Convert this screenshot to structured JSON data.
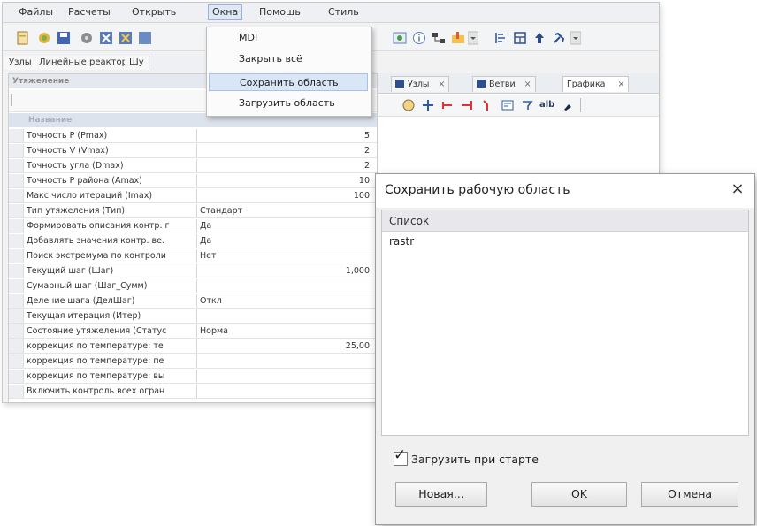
{
  "menubar": {
    "items": [
      "Файлы",
      "Расчеты",
      "Открыть",
      "Окна",
      "Помощь",
      "Стиль"
    ]
  },
  "tabs": [
    "Узлы",
    "Линейные реакторы",
    "Шу"
  ],
  "dropdown": {
    "items": [
      "MDI",
      "Закрыть всё",
      "Сохранить область",
      "Загрузить область"
    ]
  },
  "grid": {
    "title": "Утяжеление",
    "header": "Название",
    "rows": [
      {
        "name": "Точность P (Pmax)",
        "value": "5"
      },
      {
        "name": "Точность V (Vmax)",
        "value": "2"
      },
      {
        "name": "Точность угла (Dmax)",
        "value": "2"
      },
      {
        "name": "Точность P района (Amax)",
        "value": "10"
      },
      {
        "name": "Макс число итераций (Imax)",
        "value": "100"
      },
      {
        "name": "Тип утяжеления (Тип)",
        "value": "Стандарт"
      },
      {
        "name": "Формировать описания контр. г",
        "value": "Да"
      },
      {
        "name": "Добавлять значения контр. ве.",
        "value": "Да"
      },
      {
        "name": "Поиск экстремума по контроли",
        "value": "Нет"
      },
      {
        "name": "Текущий шаг (Шаг)",
        "value": "1,000"
      },
      {
        "name": "Сумарный шаг (Шаг_Сумм)",
        "value": ""
      },
      {
        "name": "Деление шага (ДелШаг)",
        "value": "Откл"
      },
      {
        "name": "Текущая итерация (Итер)",
        "value": ""
      },
      {
        "name": "Состояние утяжеления (Статус",
        "value": "Норма"
      },
      {
        "name": "коррекция по температуре: те",
        "value": "25,00"
      },
      {
        "name": "коррекция по температуре: пе",
        "value": ""
      },
      {
        "name": "коррекция по температуре: вы",
        "value": ""
      },
      {
        "name": "Включить контроль всех огран",
        "value": ""
      }
    ]
  },
  "right_panel": {
    "tabs": [
      "Узлы",
      "Ветви",
      "Графика"
    ],
    "tool_text": "alb"
  },
  "dialog": {
    "title": "Сохранить рабочую область",
    "close": "×",
    "list_header": "Список",
    "list_items": [
      "rastr"
    ],
    "checkbox_label": "Загрузить при старте",
    "checkbox_checked": true,
    "buttons": {
      "new": "Новая...",
      "ok": "OK",
      "cancel": "Отмена"
    }
  }
}
